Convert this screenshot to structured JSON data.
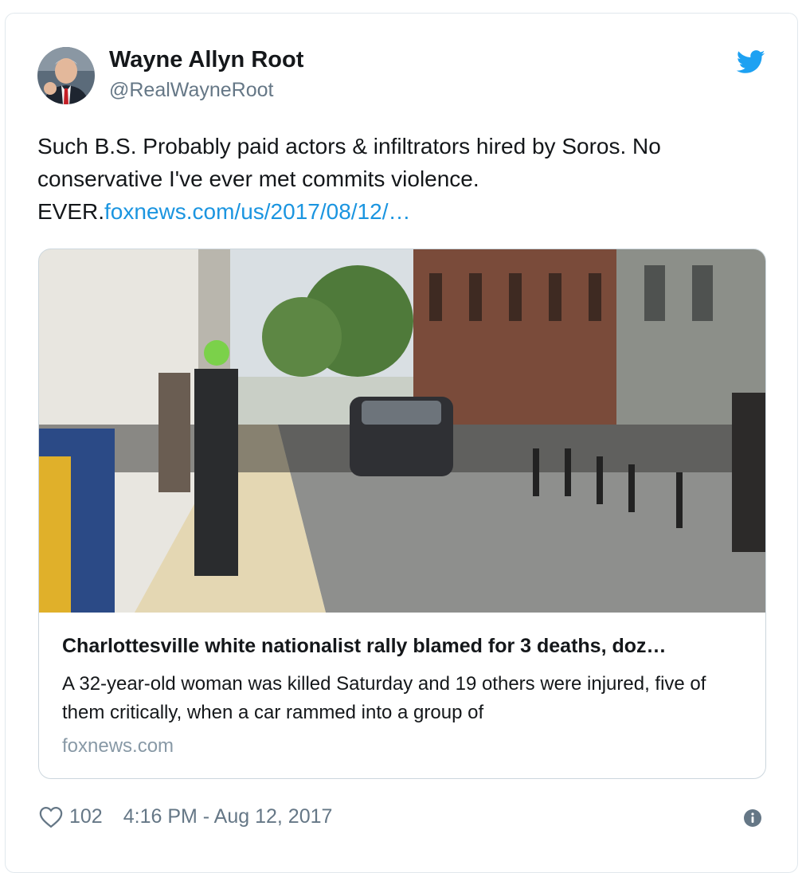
{
  "tweet": {
    "author_name": "Wayne Allyn Root",
    "author_handle": "@RealWayneRoot",
    "text": "Such B.S. Probably paid actors & infiltrators hired by Soros. No conservative I've ever met commits violence. EVER.",
    "link_text": "foxnews.com/us/2017/08/12/…",
    "likes": "102",
    "timestamp": "4:16 PM - Aug 12, 2017"
  },
  "card": {
    "title": "Charlottesville white nationalist rally blamed for 3 deaths, doz…",
    "description": "A 32-year-old woman was killed Saturday and 19 others were injured, five of them critically, when a car rammed into a group of",
    "domain": "foxnews.com"
  },
  "icons": {
    "brand": "twitter-bird-icon",
    "like": "heart-icon",
    "info": "info-icon"
  },
  "colors": {
    "twitter_blue": "#1da1f2",
    "link": "#1b95e0",
    "secondary_text": "#657786"
  }
}
